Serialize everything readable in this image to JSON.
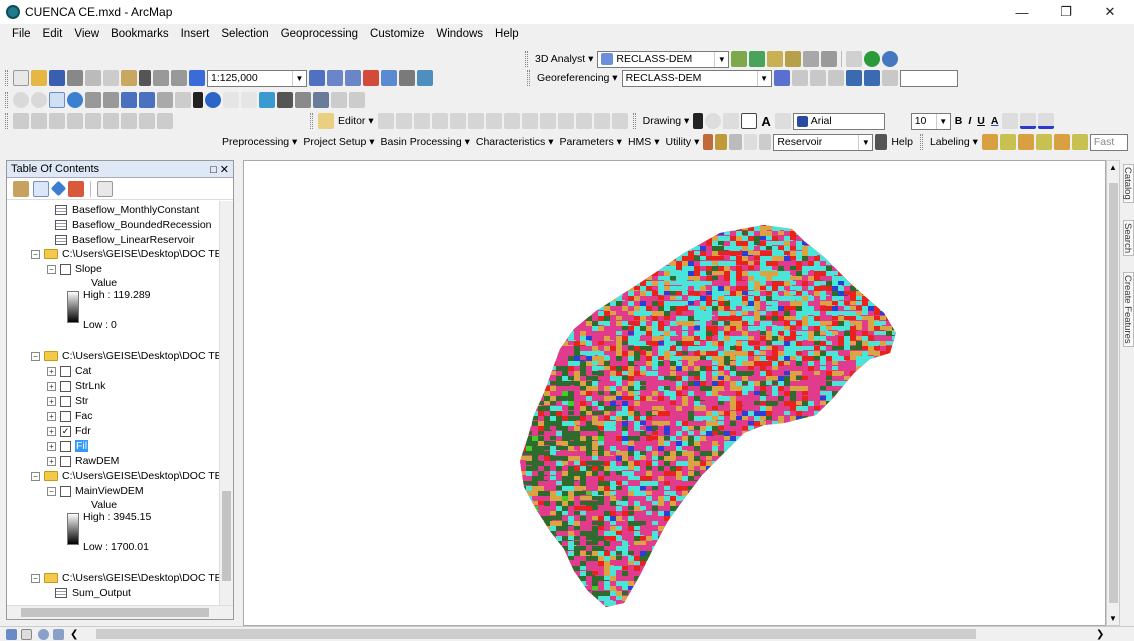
{
  "window": {
    "title": "CUENCA CE.mxd - ArcMap",
    "controls": {
      "minimize": "—",
      "maximize": "❐",
      "close": "✕"
    }
  },
  "menu": [
    "File",
    "Edit",
    "View",
    "Bookmarks",
    "Insert",
    "Selection",
    "Geoprocessing",
    "Customize",
    "Windows",
    "Help"
  ],
  "toolbars": {
    "analyst_3d": {
      "label": "3D Analyst ▾",
      "layer": "RECLASS-DEM"
    },
    "scale": "1:125,000",
    "georeferencing": {
      "label": "Georeferencing ▾",
      "layer": "RECLASS-DEM"
    },
    "editor": "Editor ▾",
    "drawing": "Drawing ▾",
    "font": "Arial",
    "font_size": "10",
    "text_style": {
      "bold": "B",
      "italic": "I",
      "underline": "U"
    },
    "hydro": {
      "items": [
        "Preprocessing ▾",
        "Project Setup ▾",
        "Basin Processing ▾",
        "Characteristics ▾",
        "Parameters ▾",
        "HMS ▾",
        "Utility ▾"
      ],
      "layer": "Reservoir",
      "help": "Help"
    },
    "labeling": "Labeling ▾",
    "labeling_mode": "Fast"
  },
  "toc": {
    "title": "Table Of Contents",
    "pin": "□ ✕",
    "rows": [
      {
        "label": "Baseflow_MonthlyConstant"
      },
      {
        "label": "Baseflow_BoundedRecession"
      },
      {
        "label": "Baseflow_LinearReservoir"
      },
      {
        "label": "C:\\Users\\GEISE\\Desktop\\DOC TESIS\\"
      },
      {
        "label": "Slope"
      },
      {
        "label": "C:\\Users\\GEISE\\Desktop\\DOC TESIS\\"
      },
      {
        "label": "Cat"
      },
      {
        "label": "StrLnk"
      },
      {
        "label": "Str"
      },
      {
        "label": "Fac"
      },
      {
        "label": "Fdr"
      },
      {
        "label": "Fil"
      },
      {
        "label": "RawDEM"
      },
      {
        "label": "C:\\Users\\GEISE\\Desktop\\DOC TESIS\\"
      },
      {
        "label": "MainViewDEM"
      },
      {
        "label": "C:\\Users\\GEISE\\Desktop\\DOC TESIS\\"
      },
      {
        "label": "Sum_Output"
      }
    ],
    "slope_legend": {
      "value": "Value",
      "high": "High : 119.289",
      "low": "Low : 0"
    },
    "dem_legend": {
      "value": "Value",
      "high": "High : 3945.15",
      "low": "Low : 1700.01"
    }
  },
  "sidebar_tabs": [
    "Catalog",
    "Search",
    "Create Features"
  ],
  "map": {
    "classes": [
      "#2f6b2c",
      "#e03b8d",
      "#49e5d8",
      "#d9a441",
      "#e8231e",
      "#2a3fd6",
      "#3fcf2a"
    ]
  }
}
